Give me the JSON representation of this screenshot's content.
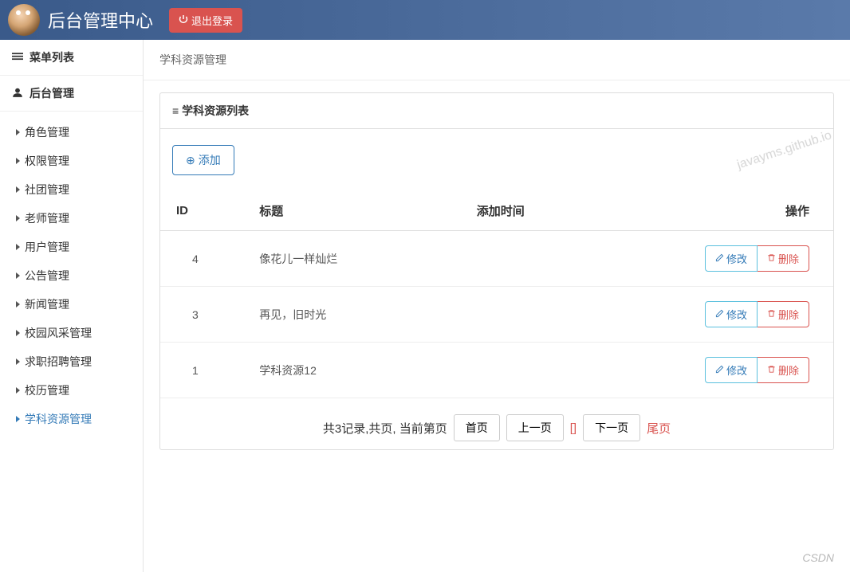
{
  "header": {
    "title": "后台管理中心",
    "logout_label": "退出登录"
  },
  "sidebar": {
    "menu_title": "菜单列表",
    "section_title": "后台管理",
    "items": [
      {
        "label": "角色管理",
        "active": false
      },
      {
        "label": "权限管理",
        "active": false
      },
      {
        "label": "社团管理",
        "active": false
      },
      {
        "label": "老师管理",
        "active": false
      },
      {
        "label": "用户管理",
        "active": false
      },
      {
        "label": "公告管理",
        "active": false
      },
      {
        "label": "新闻管理",
        "active": false
      },
      {
        "label": "校园风采管理",
        "active": false
      },
      {
        "label": "求职招聘管理",
        "active": false
      },
      {
        "label": "校历管理",
        "active": false
      },
      {
        "label": "学科资源管理",
        "active": true
      }
    ]
  },
  "main": {
    "breadcrumb": "学科资源管理",
    "panel_title": "学科资源列表",
    "add_label": "添加",
    "table": {
      "headers": {
        "id": "ID",
        "title": "标题",
        "time": "添加时间",
        "actions": "操作"
      },
      "edit_label": "修改",
      "delete_label": "删除",
      "rows": [
        {
          "id": "4",
          "title": "像花儿一样灿烂",
          "time": ""
        },
        {
          "id": "3",
          "title": "再见，旧时光",
          "time": ""
        },
        {
          "id": "1",
          "title": "学科资源12",
          "time": ""
        }
      ]
    },
    "pagination": {
      "summary": "共3记录,共页, 当前第页",
      "first": "首页",
      "prev": "上一页",
      "current": "[]",
      "next": "下一页",
      "last": "尾页"
    }
  },
  "watermarks": {
    "w1": "javayms.github.io",
    "w2": "CSDN"
  }
}
